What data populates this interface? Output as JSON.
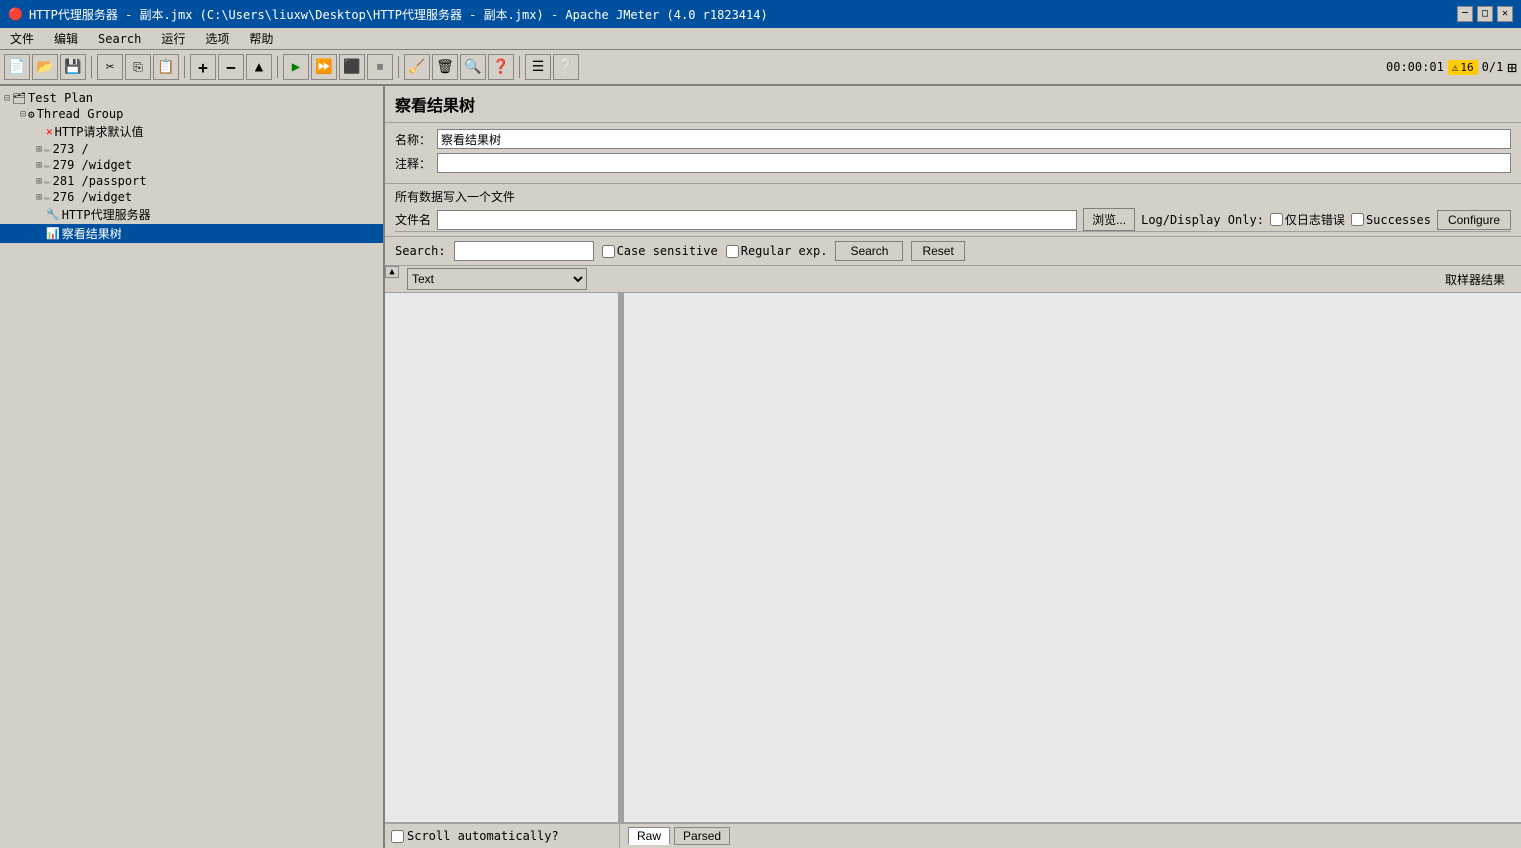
{
  "window": {
    "title": "HTTP代理服务器 - 副本.jmx (C:\\Users\\liuxw\\Desktop\\HTTP代理服务器 - 副本.jmx) - Apache JMeter (4.0 r1823414)",
    "icon": "🔴"
  },
  "titlebar_controls": {
    "minimize": "─",
    "maximize": "□",
    "close": "✕"
  },
  "menubar": {
    "items": [
      "文件",
      "编辑",
      "Search",
      "运行",
      "选项",
      "帮助"
    ]
  },
  "toolbar": {
    "buttons": [
      "📁",
      "💾",
      "✂️",
      "📋",
      "📋",
      "➕",
      "➖",
      "⬆️",
      "▶",
      "▶▶",
      "⏸",
      "⏹",
      "📊",
      "💾",
      "🔍",
      "💡",
      "☰",
      "❓"
    ],
    "timer": "00:00:01",
    "warning_icon": "⚠",
    "warning_count": "16",
    "page_count": "0/1",
    "expand_icon": "⊞"
  },
  "tree": {
    "items": [
      {
        "id": "test-plan",
        "label": "Test Plan",
        "indent": 0,
        "icon": "🗂",
        "expand": "⊟",
        "selected": false
      },
      {
        "id": "thread-group",
        "label": "Thread Group",
        "indent": 1,
        "icon": "⚙",
        "expand": "⊟",
        "selected": false
      },
      {
        "id": "http-defaults",
        "label": "HTTP请求默认值",
        "indent": 2,
        "icon": "✕",
        "expand": "",
        "selected": false
      },
      {
        "id": "item-273",
        "label": "273 /",
        "indent": 2,
        "icon": "✏",
        "expand": "⊞",
        "selected": false
      },
      {
        "id": "item-279",
        "label": "279 /widget",
        "indent": 2,
        "icon": "✏",
        "expand": "⊞",
        "selected": false
      },
      {
        "id": "item-281",
        "label": "281 /passport",
        "indent": 2,
        "icon": "✏",
        "expand": "⊞",
        "selected": false
      },
      {
        "id": "item-276",
        "label": "276 /widget",
        "indent": 2,
        "icon": "✏",
        "expand": "⊞",
        "selected": false
      },
      {
        "id": "http-proxy",
        "label": "HTTP代理服务器",
        "indent": 2,
        "icon": "🔧",
        "expand": "",
        "selected": false
      },
      {
        "id": "result-tree",
        "label": "察看结果树",
        "indent": 2,
        "icon": "📊",
        "expand": "",
        "selected": true
      }
    ]
  },
  "panel": {
    "title": "察看结果树",
    "name_label": "名称：",
    "name_value": "察看结果树",
    "comment_label": "注释：",
    "comment_value": "",
    "file_section_label": "所有数据写入一个文件",
    "file_name_label": "文件名",
    "file_name_value": "",
    "browse_btn": "浏览...",
    "log_display_label": "Log/Display Only:",
    "errors_checkbox_label": "仅日志错误",
    "successes_checkbox_label": "Successes",
    "configure_btn": "Configure",
    "search_label": "Search:",
    "search_value": "",
    "case_sensitive_label": "Case sensitive",
    "regular_exp_label": "Regular exp.",
    "search_btn": "Search",
    "reset_btn": "Reset",
    "type_dropdown": "Text",
    "left_pane_header": "",
    "right_pane_header": "取样器结果",
    "scroll_label": "Scroll automatically?",
    "raw_tab": "Raw",
    "parsed_tab": "Parsed"
  }
}
